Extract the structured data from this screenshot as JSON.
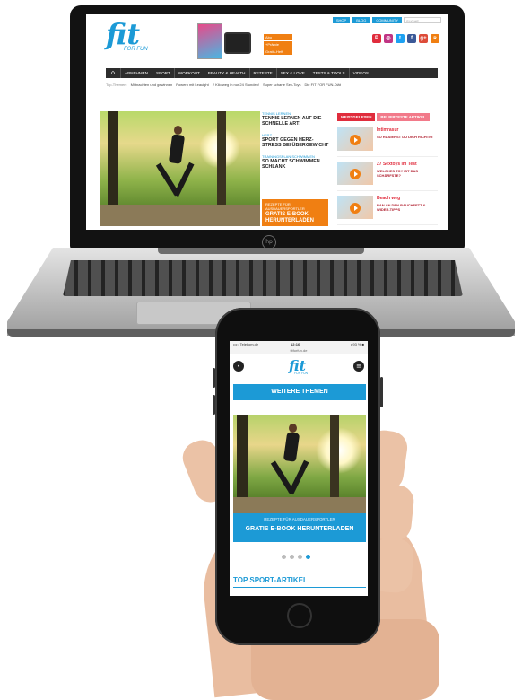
{
  "laptop": {
    "brand_mark": "hp",
    "site": {
      "top_links": [
        "SHOP",
        "BLOG",
        "COMMUNITY"
      ],
      "search_placeholder": "SUCHE",
      "logo": {
        "main": "fit",
        "sub": "FOR FUN"
      },
      "promo_tags": [
        "Abo",
        "+Prämie",
        "Gratis-Heft"
      ],
      "social_icons": [
        {
          "icon": "pinterest-icon",
          "glyph": "P",
          "color": "#e02c3c"
        },
        {
          "icon": "instagram-icon",
          "glyph": "◎",
          "color": "#c13584"
        },
        {
          "icon": "twitter-icon",
          "glyph": "t",
          "color": "#1da1f2"
        },
        {
          "icon": "facebook-icon",
          "glyph": "f",
          "color": "#3b5998"
        },
        {
          "icon": "google-plus-icon",
          "glyph": "g+",
          "color": "#dd4b39"
        },
        {
          "icon": "rss-icon",
          "glyph": "ʀ",
          "color": "#f07f12"
        }
      ],
      "nav": {
        "home_glyph": "⌂",
        "items": [
          "ABNEHMEN",
          "SPORT",
          "WORKOUT",
          "BEAUTY & HEALTH",
          "REZEPTE",
          "SEX & LOVE",
          "TESTS & TOOLS",
          "VIDEOS"
        ]
      },
      "topics": [
        "Top-Themen:",
        "Mittnachten und gewinnen",
        "Powern mit Leauight",
        "2 Kilo weg in nur 24 Stunden!",
        "Super scharfe Sex-Toys",
        "Die FIT FOR FUN-Diät"
      ],
      "sidebar": [
        {
          "tag": "TENNIS LERNEN",
          "title": "TENNIS LERNEN AUF DIE SCHNELLE ART!"
        },
        {
          "tag": "HERZ",
          "title": "SPORT GEGEN HERZ-STRESS BEI ÜBERGEWICHT"
        },
        {
          "tag": "TRAININGSPLAN SCHWIMMEN",
          "title": "SO MACHT SCHWIMMEN SCHLANK"
        }
      ],
      "ebook": {
        "sub": "REZEPTE FÜR AUSDAUERSPORTLER",
        "title": "GRATIS E-BOOK HERUNTERLADEN"
      },
      "tabs": [
        {
          "label": "MEISTGELESEN",
          "color": "#e02c3c"
        },
        {
          "label": "BELIEBTESTE ARTIKEL",
          "color": "#f27a8a"
        }
      ],
      "articles": [
        {
          "title": "Intimrasur",
          "sub": "SO RASIERST DU DICH RICHTIG"
        },
        {
          "title": "27 Sextoys im Test",
          "sub": "WELCHES TOY IST DAS SCHÄRFSTE?"
        },
        {
          "title": "Beach weg",
          "sub": "RAN AN DEN BAUCHFETT & WIDER-TIPPS"
        }
      ]
    }
  },
  "phone": {
    "status": {
      "carrier": "•••○ Telekom.de",
      "time": "12:16",
      "battery": "• 93 % ■"
    },
    "url": "fitforfun.de",
    "back_glyph": "‹",
    "menu_glyph": "≡",
    "logo": {
      "main": "fit",
      "sub": "FOR FUN"
    },
    "themen_label": "WEITERE THEMEN",
    "ebook": {
      "sub": "REZEPTE FÜR AUSDAUERSPORTLER",
      "title": "GRATIS E-BOOK HERUNTERLADEN"
    },
    "carousel": {
      "count": 4,
      "active": 4
    },
    "section_title": "TOP SPORT-ARTIKEL"
  }
}
